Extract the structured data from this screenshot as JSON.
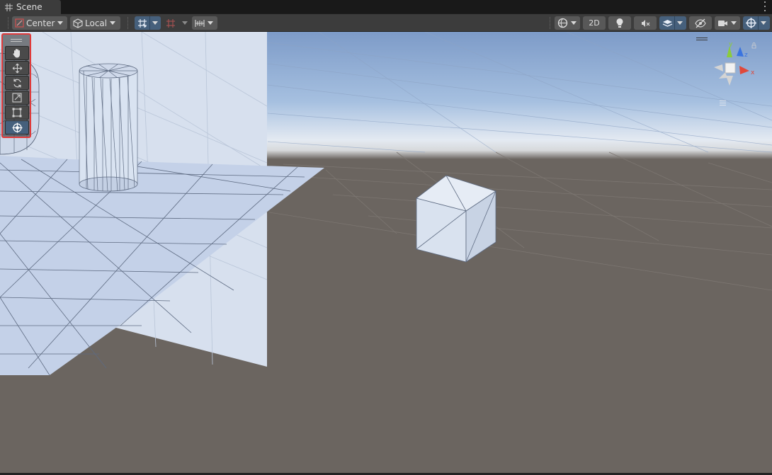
{
  "window": {
    "tab_title": "Scene",
    "tab_icon": "grid-icon",
    "menu_icon": "kebab-menu-icon"
  },
  "toolbar": {
    "pivot_label": "Center",
    "space_label": "Local",
    "mode_2d_label": "2D",
    "icons": {
      "pivot": "pivot-center-icon",
      "space": "local-space-icon",
      "grid": "grid-snap-icon",
      "increment": "increment-snap-icon",
      "ruler": "ruler-icon",
      "draw_mode": "draw-mode-sphere-icon",
      "lighting": "lighting-bulb-icon",
      "audio": "audio-mute-icon",
      "effects": "effects-layers-icon",
      "visibility": "scene-visibility-icon",
      "camera": "camera-icon",
      "gizmos": "gizmos-icon"
    }
  },
  "tools": {
    "handle_icon": "overlay-handle-icon",
    "items": [
      {
        "name": "view-tool",
        "icon": "hand-icon",
        "active": false
      },
      {
        "name": "move-tool",
        "icon": "move-arrows-icon",
        "active": false
      },
      {
        "name": "rotate-tool",
        "icon": "rotate-icon",
        "active": false
      },
      {
        "name": "scale-tool",
        "icon": "scale-icon",
        "active": false
      },
      {
        "name": "rect-tool",
        "icon": "rect-transform-icon",
        "active": false
      },
      {
        "name": "transform-tool",
        "icon": "transform-icon",
        "active": true
      }
    ]
  },
  "orientation_gizmo": {
    "axes": {
      "y": "y",
      "x": "x",
      "z": "z"
    },
    "colors": {
      "x": "#e0483a",
      "y": "#8ccc3a",
      "z": "#3a74e0"
    }
  },
  "colors": {
    "toolbar_bg": "#3c3c3c",
    "button_bg": "#585858",
    "button_active": "#46607c",
    "selection_outline": "#e03a3a",
    "ground": "#6b6560",
    "sky": "#a6c0e0"
  }
}
